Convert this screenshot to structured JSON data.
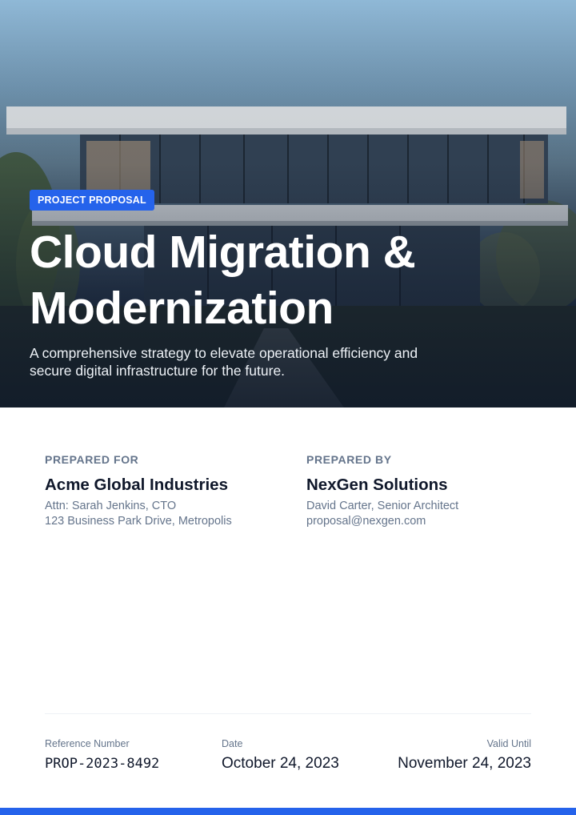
{
  "hero": {
    "badge": "PROJECT PROPOSAL",
    "title_lines": [
      "Cloud Migration &",
      "Modernization"
    ],
    "subtitle_lines": [
      "A comprehensive strategy to elevate operational efficiency and",
      "secure digital infrastructure for the future."
    ]
  },
  "prepared_for": {
    "label": "PREPARED FOR",
    "name": "Acme Global Industries",
    "lines": [
      "Attn: Sarah Jenkins, CTO",
      "123 Business Park Drive, Metropolis"
    ]
  },
  "prepared_by": {
    "label": "PREPARED BY",
    "name": "NexGen Solutions",
    "lines": [
      "David Carter, Senior Architect",
      "proposal@nexgen.com"
    ]
  },
  "meta": {
    "reference": {
      "label": "Reference Number",
      "value": "PROP-2023-8492"
    },
    "date": {
      "label": "Date",
      "value": "October 24, 2023"
    },
    "valid_until": {
      "label": "Valid Until",
      "value": "November 24, 2023"
    }
  },
  "colors": {
    "accent": "#2563eb",
    "heading": "#0f172a",
    "muted": "#64748b"
  }
}
